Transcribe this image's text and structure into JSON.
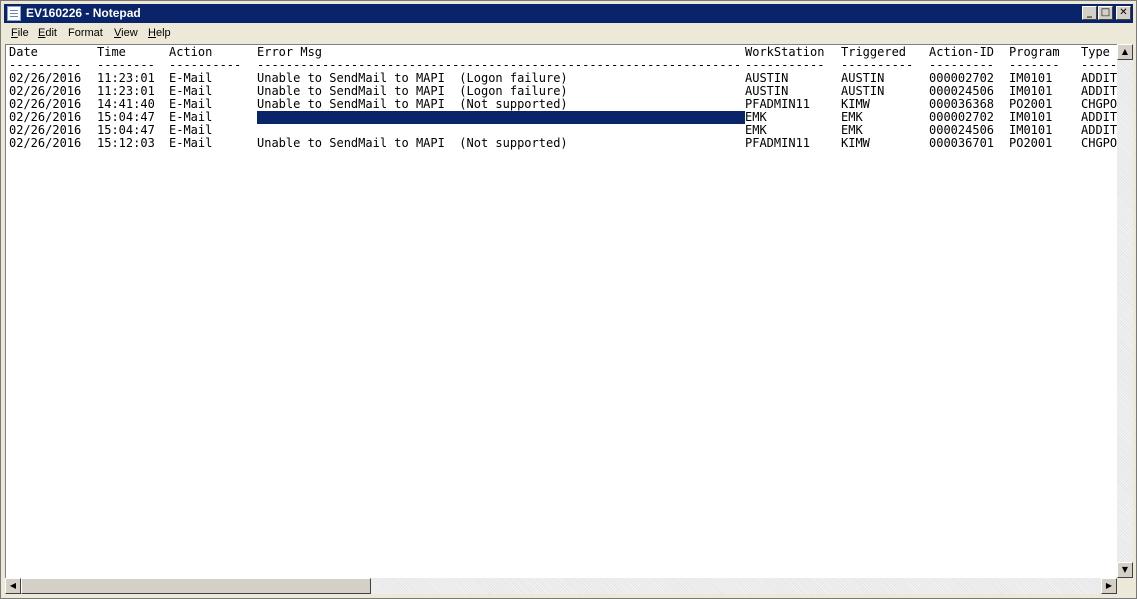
{
  "window": {
    "title": "EV160226 - Notepad",
    "controls": {
      "minimize": "_",
      "maximize": "□",
      "close": "✕"
    }
  },
  "menu": {
    "items": [
      {
        "key": "F",
        "rest": "ile"
      },
      {
        "key": "E",
        "rest": "dit"
      },
      {
        "key": "",
        "rest": "Format"
      },
      {
        "key": "V",
        "rest": "iew"
      },
      {
        "key": "H",
        "rest": "elp"
      }
    ]
  },
  "editor": {
    "headers": [
      "Date",
      "Time",
      "Action",
      "Error Msg",
      "WorkStation",
      "Triggered",
      "Action-ID",
      "Program",
      "Type"
    ],
    "separators": [
      "----------",
      "--------",
      "----------",
      "-------------------------------------------------------------------",
      "-----------",
      "----------",
      "---------",
      "-------",
      "-----"
    ],
    "rows": [
      [
        "02/26/2016",
        "11:23:01",
        "E-Mail",
        "Unable to SendMail to MAPI  (Logon failure)",
        "AUSTIN",
        "AUSTIN",
        "000002702",
        "IM0101",
        "ADDIT"
      ],
      [
        "02/26/2016",
        "11:23:01",
        "E-Mail",
        "Unable to SendMail to MAPI  (Logon failure)",
        "AUSTIN",
        "AUSTIN",
        "000024506",
        "IM0101",
        "ADDIT"
      ],
      [
        "02/26/2016",
        "14:41:40",
        "E-Mail",
        "Unable to SendMail to MAPI  (Not supported)",
        "PFADMIN11",
        "KIMW",
        "000036368",
        "PO2001",
        "CHGPO"
      ],
      [
        "02/26/2016",
        "15:04:47",
        "E-Mail",
        "",
        "EMK",
        "EMK",
        "000002702",
        "IM0101",
        "ADDIT"
      ],
      [
        "02/26/2016",
        "15:04:47",
        "E-Mail",
        "",
        "EMK",
        "EMK",
        "000024506",
        "IM0101",
        "ADDIT"
      ],
      [
        "02/26/2016",
        "15:12:03",
        "E-Mail",
        "Unable to SendMail to MAPI  (Not supported)",
        "PFADMIN11",
        "KIMW",
        "000036701",
        "PO2001",
        "CHGPO"
      ]
    ],
    "selected_row": 3
  },
  "scrollbars": {
    "left_arrow": "◀",
    "right_arrow": "▶",
    "up_arrow": "▲",
    "down_arrow": "▼"
  },
  "colors": {
    "titlebar": "#0a246a",
    "selection": "#0a246a"
  }
}
